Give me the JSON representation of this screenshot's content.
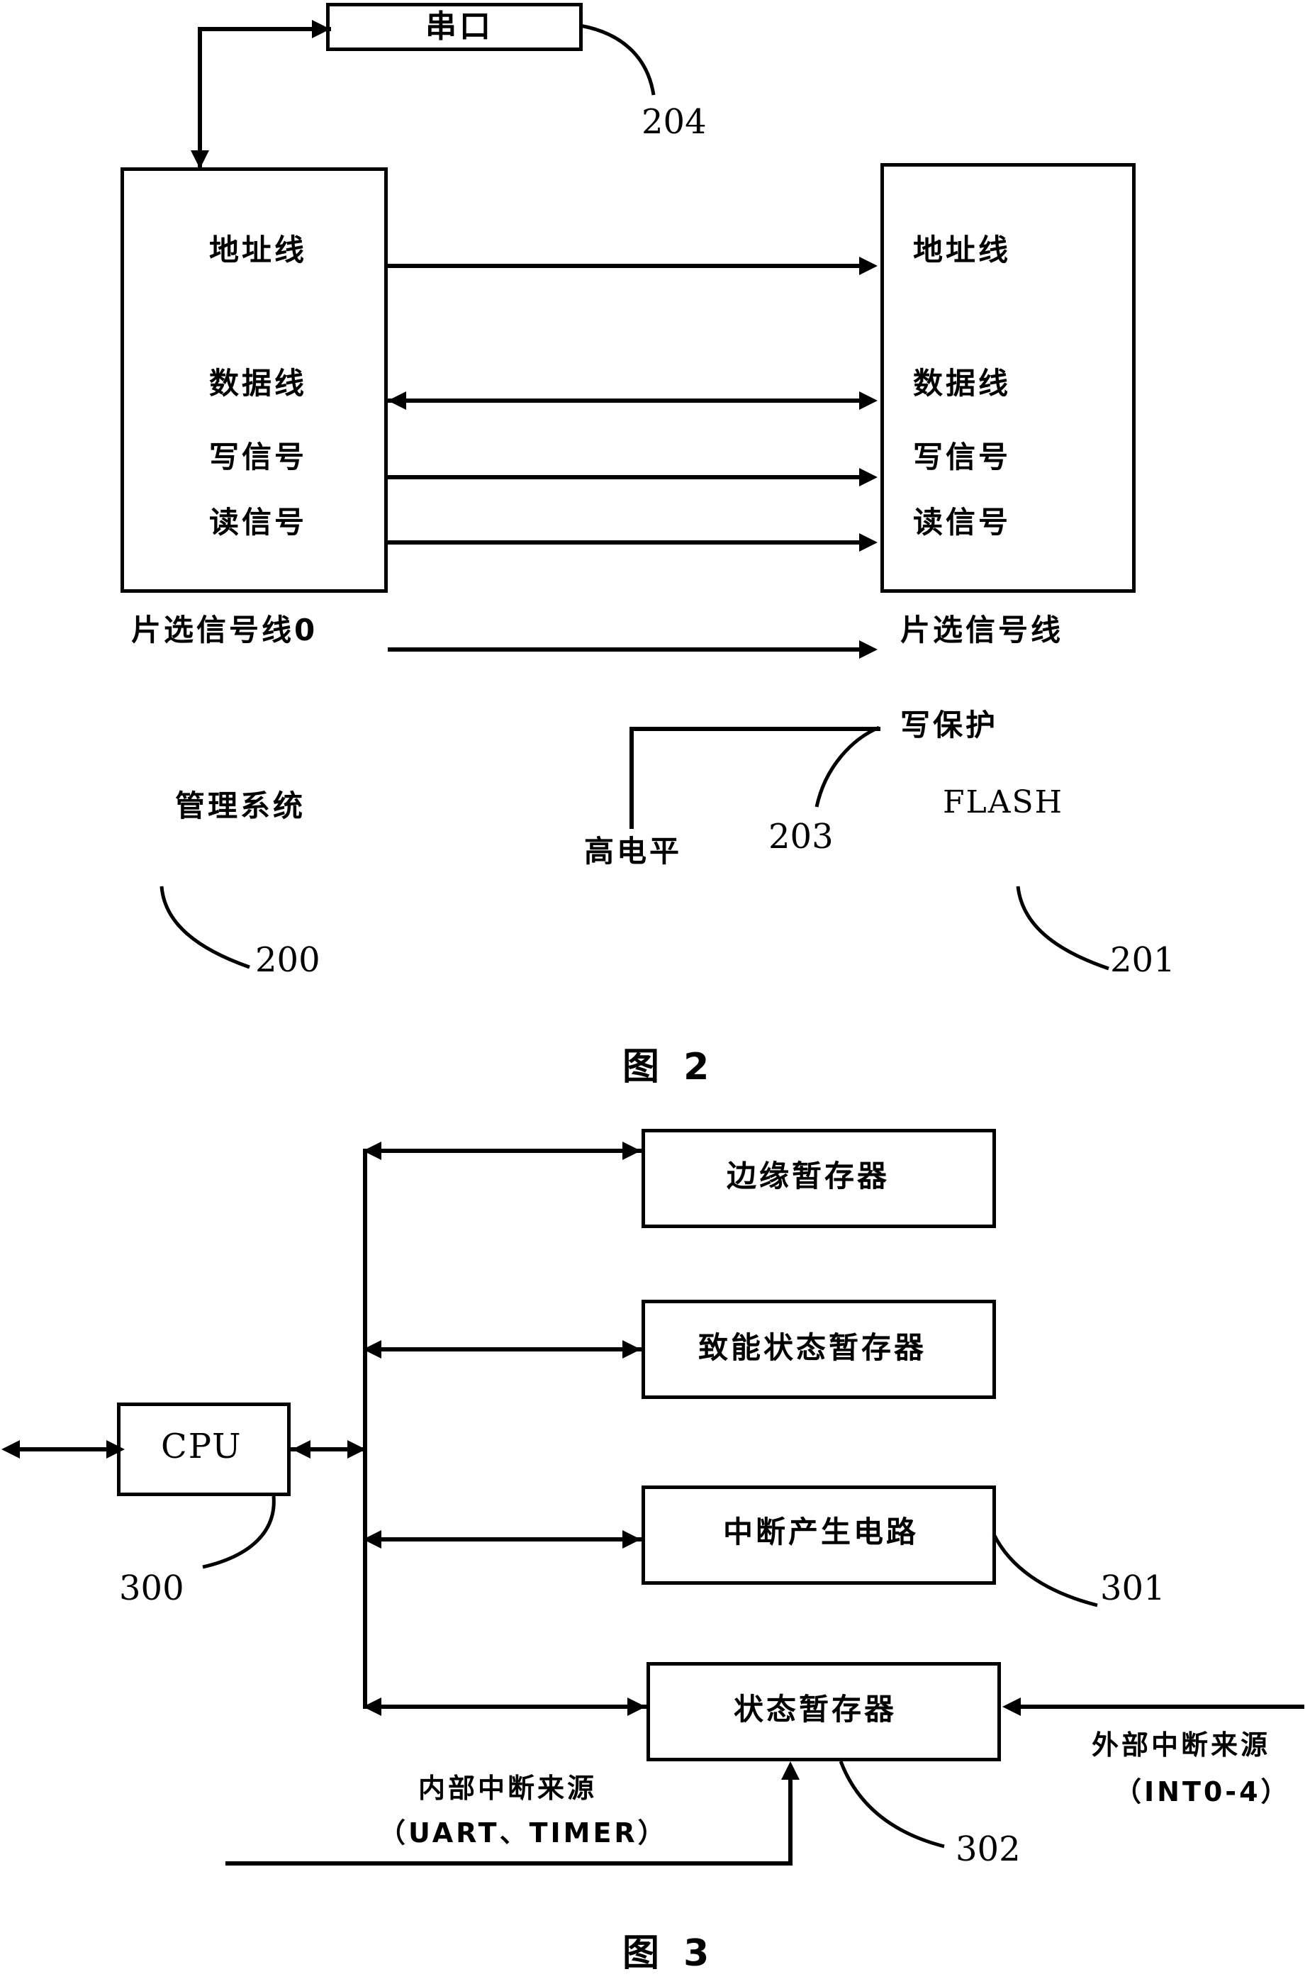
{
  "figures": [
    {
      "id": "figure-2",
      "caption": "图 2",
      "blocks": {
        "serial_port": {
          "label": "串口",
          "ref": "204"
        },
        "management_system": {
          "title": "管理系统",
          "ref": "200",
          "pins": [
            "地址线",
            "数据线",
            "写信号",
            "读信号",
            "片选信号线0"
          ]
        },
        "flash": {
          "title": "FLASH",
          "ref": "201",
          "pins": [
            "地址线",
            "数据线",
            "写信号",
            "读信号",
            "片选信号线",
            "写保护"
          ]
        },
        "high_level": {
          "label": "高电平",
          "ref": "203"
        }
      },
      "signals": [
        {
          "name": "地址线",
          "direction": "right"
        },
        {
          "name": "数据线",
          "direction": "both"
        },
        {
          "name": "写信号",
          "direction": "right"
        },
        {
          "name": "读信号",
          "direction": "right"
        },
        {
          "name": "片选信号线0",
          "direction": "right"
        }
      ]
    },
    {
      "id": "figure-3",
      "caption": "图 3",
      "blocks": {
        "cpu": {
          "label": "CPU",
          "ref": "300"
        },
        "edge_register": {
          "label": "边缘暂存器"
        },
        "enable_status_register": {
          "label": "致能状态暂存器"
        },
        "interrupt_generation_circuit": {
          "label": "中断产生电路",
          "ref": "301"
        },
        "status_register": {
          "label": "状态暂存器",
          "ref": "302"
        }
      },
      "sources": {
        "internal": {
          "line1": "内部中断来源",
          "line2": "（UART、TIMER）"
        },
        "external": {
          "line1": "外部中断来源",
          "line2": "（INT0-4）"
        }
      }
    }
  ],
  "colors": {
    "ink": "#000000",
    "paper": "#ffffff"
  }
}
